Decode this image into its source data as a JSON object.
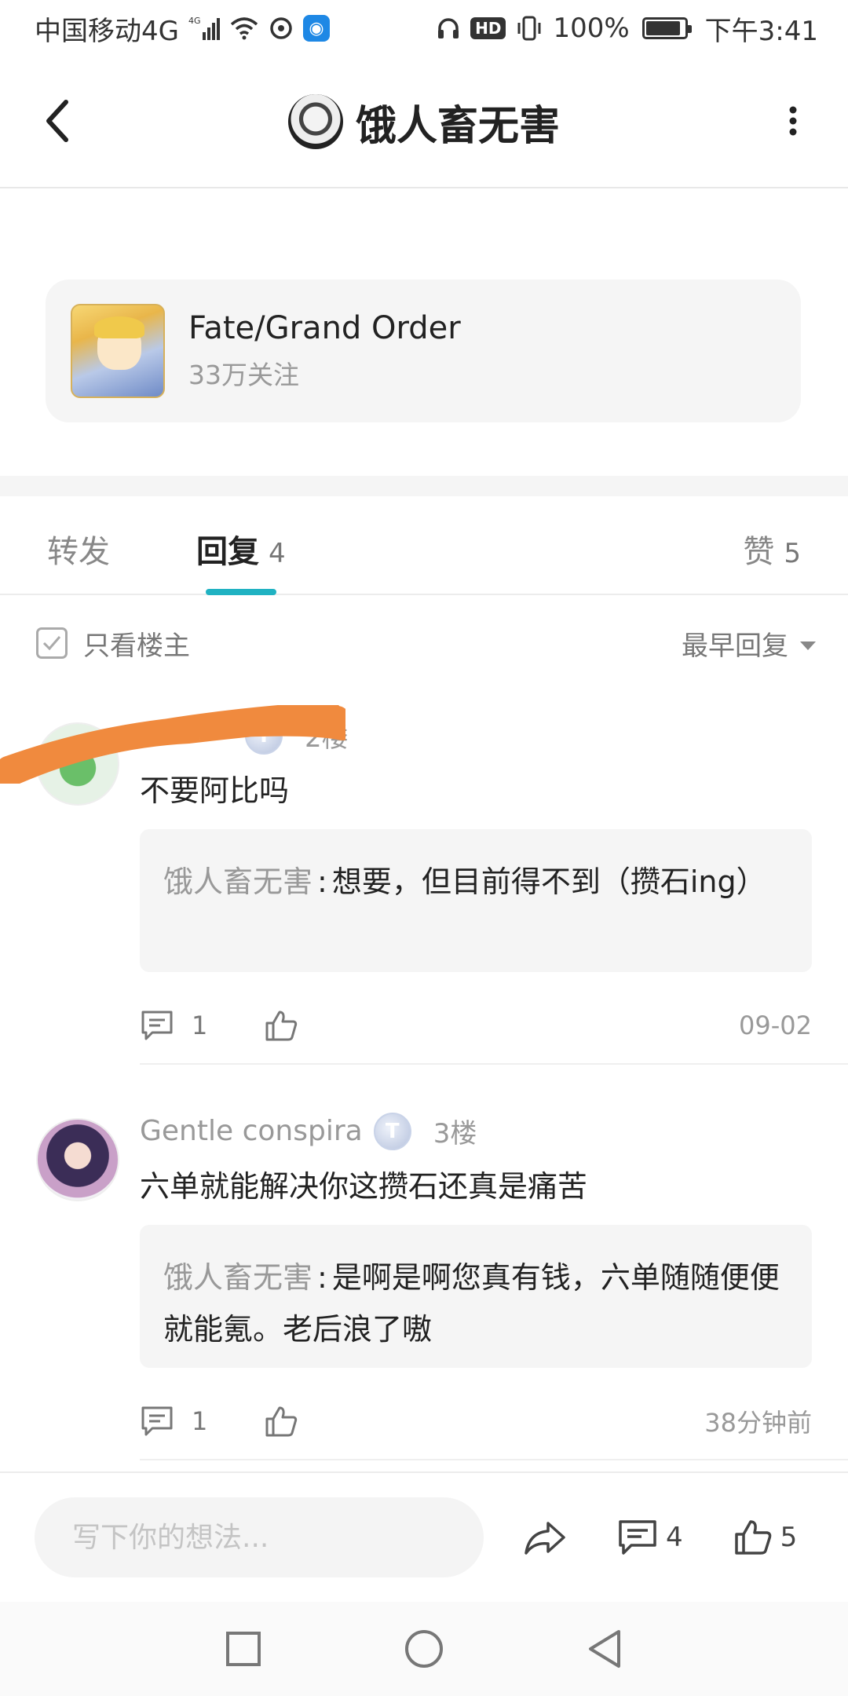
{
  "status_bar": {
    "carrier": "中国移动4G",
    "network_small": "4G",
    "battery_text": "100%",
    "battery_level": 0.9,
    "hd": "HD",
    "time": "下午3:41"
  },
  "header": {
    "title": "饿人畜无害",
    "back_icon": "back-arrow-icon",
    "more_icon": "more-vertical-icon"
  },
  "forum": {
    "name": "Fate/Grand Order",
    "followers": "33万关注"
  },
  "tabs": {
    "forward_label": "转发",
    "reply_label": "回复",
    "reply_count": "4",
    "like_label": "赞",
    "like_count": "5"
  },
  "filter": {
    "only_owner_label": "只看楼主",
    "sort_label": "最早回复"
  },
  "replies": [
    {
      "username": "",
      "level": "T",
      "floor": "2楼",
      "text": "不要阿比吗",
      "quote_author": "饿人畜无害",
      "quote_sep": ":",
      "quote_text": "想要，但目前得不到（攒石ing）",
      "comment_count": "1",
      "time": "09-02"
    },
    {
      "username": "Gentle conspira",
      "level": "T",
      "floor": "3楼",
      "text": "六单就能解决你这攒石还真是痛苦",
      "quote_author": "饿人畜无害",
      "quote_sep": ":",
      "quote_text": "是啊是啊您真有钱，六单随随便便就能氪。老后浪了嗷",
      "comment_count": "1",
      "time": "38分钟前"
    }
  ],
  "bottom_bar": {
    "input_placeholder": "写下你的想法...",
    "comment_count": "4",
    "like_count": "5"
  },
  "colors": {
    "accent": "#20b2c2",
    "scribble": "#f08a3e"
  }
}
